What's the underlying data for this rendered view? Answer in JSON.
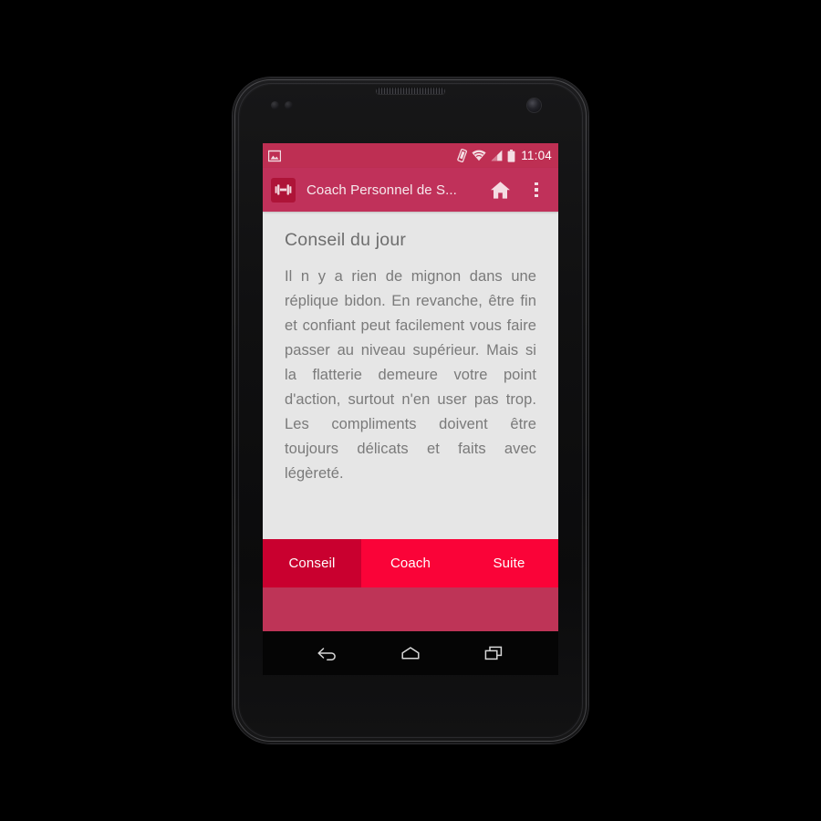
{
  "device": {
    "name": "android-phone-nexus",
    "nav": {
      "back_label": "Back",
      "home_label": "Home",
      "recents_label": "Recent apps"
    }
  },
  "statusbar": {
    "notification_icon": "image-notification-icon",
    "vibrate_icon": "vibrate-icon",
    "wifi_icon": "wifi-icon",
    "signal_icon": "cellular-signal-icon",
    "battery_icon": "battery-full-icon",
    "time": "11:04"
  },
  "appbar": {
    "logo_icon": "dumbbell-icon",
    "title": "Coach Personnel de S...",
    "home_action_icon": "home-icon",
    "overflow_action_icon": "overflow-menu-icon",
    "background_color": "#C0315A"
  },
  "content": {
    "heading": "Conseil du jour",
    "body": "Il n y a rien de mignon dans une réplique bidon. En revanche, être fin et confiant peut facilement vous faire passer au niveau supérieur. Mais si la flatterie demeure votre point d'action, surtout n'en user pas trop. Les compliments doivent être toujours délicats et faits avec légèreté.",
    "background_color": "#E6E6E6"
  },
  "tabs": {
    "selected_index": 0,
    "selected_color": "#C9002F",
    "bar_color": "#FA0338",
    "items": [
      {
        "label": "Conseil",
        "selected": true
      },
      {
        "label": "Coach",
        "selected": false
      },
      {
        "label": "Suite",
        "selected": false
      }
    ]
  },
  "lower_bar": {
    "color": "#BE3457"
  }
}
